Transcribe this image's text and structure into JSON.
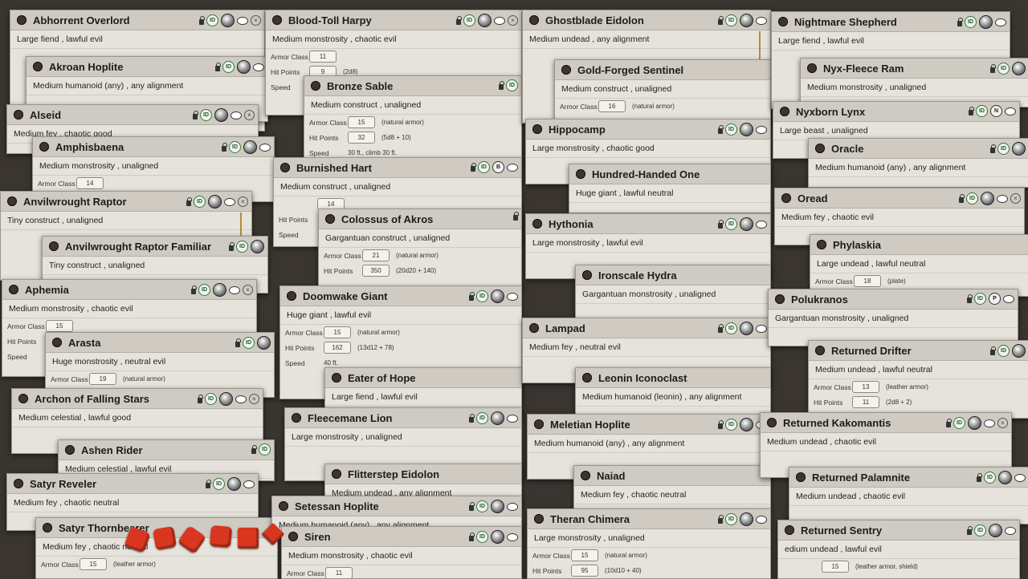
{
  "cards": {
    "abhorrent_overlord": {
      "name": "Abhorrent Overlord",
      "sub": "Large fiend , lawful evil"
    },
    "blood_toll_harpy": {
      "name": "Blood-Toll Harpy",
      "sub": "Medium monstrosity , chaotic evil",
      "ac_label": "Armor Class",
      "ac": "11",
      "hp_label": "Hit Points",
      "hp": "9",
      "hp_note": "(2d8)",
      "speed_label": "Speed"
    },
    "ghostblade_eidolon": {
      "name": "Ghostblade Eidolon",
      "sub": "Medium undead , any alignment"
    },
    "nightmare_shepherd": {
      "name": "Nightmare Shepherd",
      "sub": "Large fiend , lawful evil"
    },
    "akroan_hoplite": {
      "name": "Akroan Hoplite",
      "sub": "Medium humanoid (any) , any alignment"
    },
    "bronze_sable": {
      "name": "Bronze Sable",
      "sub": "Medium construct , unaligned",
      "ac_label": "Armor Class",
      "ac": "15",
      "ac_note": "(natural armor)",
      "hp_label": "Hit Points",
      "hp": "32",
      "hp_note": "(5d8 + 10)",
      "speed_label": "Speed",
      "speed": "30 ft., climb 30 ft."
    },
    "gold_forged_sentinel": {
      "name": "Gold-Forged Sentinel",
      "sub": "Medium construct , unaligned",
      "ac_label": "Armor Class",
      "ac": "16",
      "ac_note": "(natural armor)"
    },
    "nyx_fleece_ram": {
      "name": "Nyx-Fleece Ram",
      "sub": "Medium monstrosity , unaligned"
    },
    "alseid": {
      "name": "Alseid",
      "sub": "Medium fey , chaotic good"
    },
    "nyxborn_lynx": {
      "name": "Nyxborn Lynx",
      "sub": "Large beast , unaligned"
    },
    "amphisbaena": {
      "name": "Amphisbaena",
      "sub": "Medium monstrosity , unaligned",
      "ac_label": "Armor Class",
      "ac": "14"
    },
    "hippocamp": {
      "name": "Hippocamp",
      "sub": "Large monstrosity , chaotic good"
    },
    "oracle": {
      "name": "Oracle",
      "sub": "Medium humanoid (any) , any alignment"
    },
    "burnished_hart": {
      "name": "Burnished Hart",
      "sub": "Medium construct , unaligned",
      "ac": "14",
      "hp_label": "Hit Points",
      "speed_label": "Speed"
    },
    "hundred_handed_one": {
      "name": "Hundred-Handed One",
      "sub": "Huge giant , lawful neutral"
    },
    "anvilwrought_raptor": {
      "name": "Anvilwrought Raptor",
      "sub": "Tiny construct , unaligned"
    },
    "oread": {
      "name": "Oread",
      "sub": "Medium fey , chaotic evil"
    },
    "colossus_of_akros": {
      "name": "Colossus of Akros",
      "sub": "Gargantuan construct , unaligned",
      "ac_label": "Armor Class",
      "ac": "21",
      "ac_note": "(natural armor)",
      "hp_label": "Hit Points",
      "hp": "350",
      "hp_note": "(20d20 + 140)"
    },
    "hythonia": {
      "name": "Hythonia",
      "sub": "Large monstrosity , lawful evil"
    },
    "anvilwrought_raptor_familiar": {
      "name": "Anvilwrought Raptor Familiar",
      "sub": "Tiny construct , unaligned"
    },
    "phylaskia": {
      "name": "Phylaskia",
      "sub": "Large undead , lawful neutral",
      "ac_label": "Armor Class",
      "ac": "18",
      "ac_note": "(plate)"
    },
    "ironscale_hydra": {
      "name": "Ironscale Hydra",
      "sub": "Gargantuan monstrosity , unaligned"
    },
    "aphemia": {
      "name": "Aphemia",
      "sub": "Medium monstrosity , chaotic evil",
      "ac_label": "Armor Class",
      "ac": "15",
      "hp_label": "Hit Points",
      "speed_label": "Speed"
    },
    "doomwake_giant": {
      "name": "Doomwake Giant",
      "sub": "Huge giant , lawful evil",
      "ac_label": "Armor Class",
      "ac": "15",
      "ac_note": "(natural armor)",
      "hp_label": "Hit Points",
      "hp": "162",
      "hp_note": "(13d12 + 78)",
      "speed_label": "Speed",
      "speed": "40 ft."
    },
    "polukranos": {
      "name": "Polukranos",
      "sub": "Gargantuan monstrosity , unaligned"
    },
    "lampad": {
      "name": "Lampad",
      "sub": "Medium fey , neutral evil"
    },
    "arasta": {
      "name": "Arasta",
      "sub": "Huge monstrosity , neutral evil",
      "ac_label": "Armor Class",
      "ac": "19",
      "ac_note": "(natural armor)"
    },
    "returned_drifter": {
      "name": "Returned Drifter",
      "sub": "Medium undead , lawful neutral",
      "ac_label": "Armor Class",
      "ac": "13",
      "ac_note": "(leather armor)",
      "hp_label": "Hit Points",
      "hp": "11",
      "hp_note": "(2d8 + 2)"
    },
    "eater_of_hope": {
      "name": "Eater of Hope",
      "sub": "Large fiend , lawful evil"
    },
    "leonin_iconoclast": {
      "name": "Leonin Iconoclast",
      "sub": "Medium humanoid (leonin) , any alignment"
    },
    "archon_of_falling_stars": {
      "name": "Archon of Falling Stars",
      "sub": "Medium celestial , lawful good"
    },
    "fleecemane_lion": {
      "name": "Fleecemane Lion",
      "sub": "Large monstrosity , unaligned"
    },
    "meletian_hoplite": {
      "name": "Meletian Hoplite",
      "sub": "Medium humanoid (any) , any alignment"
    },
    "returned_kakomantis": {
      "name": "Returned Kakomantis",
      "sub": "Medium undead , chaotic evil"
    },
    "ashen_rider": {
      "name": "Ashen Rider",
      "sub": "Medium celestial , lawful evil"
    },
    "flitterstep_eidolon": {
      "name": "Flitterstep Eidolon",
      "sub": "Medium undead , any alignment"
    },
    "naiad": {
      "name": "Naiad",
      "sub": "Medium fey , chaotic neutral"
    },
    "returned_palamnite": {
      "name": "Returned Palamnite",
      "sub": "Medium undead , chaotic evil"
    },
    "satyr_reveler": {
      "name": "Satyr Reveler",
      "sub": "Medium fey , chaotic neutral"
    },
    "setessan_hoplite": {
      "name": "Setessan Hoplite",
      "sub": "Medium humanoid (any) , any alignment"
    },
    "theran_chimera": {
      "name": "Theran Chimera",
      "sub": "Large monstrosity , unaligned",
      "ac_label": "Armor Class",
      "ac": "15",
      "ac_note": "(natural armor)",
      "hp_label": "Hit Points",
      "hp": "95",
      "hp_note": "(10d10 + 40)"
    },
    "returned_sentry": {
      "name": "Returned Sentry",
      "sub": "edium undead , lawful evil",
      "ac": "15",
      "ac_note": "(leather armor, shield)"
    },
    "satyr_thornbearer": {
      "name": "Satyr Thornbearer",
      "sub": "Medium fey , chaotic neutral",
      "ac_label": "Armor Class",
      "ac": "15",
      "ac_note": "(leather armor)"
    },
    "siren": {
      "name": "Siren",
      "sub": "Medium monstrosity , chaotic evil",
      "ac_label": "Armor Class",
      "ac": "11"
    }
  },
  "colors": {
    "background": "#3a3530",
    "card": "#e6e3dc",
    "header": "#cfcbc3",
    "dice": "#d9361f",
    "id_badge": "#2e7d32"
  }
}
